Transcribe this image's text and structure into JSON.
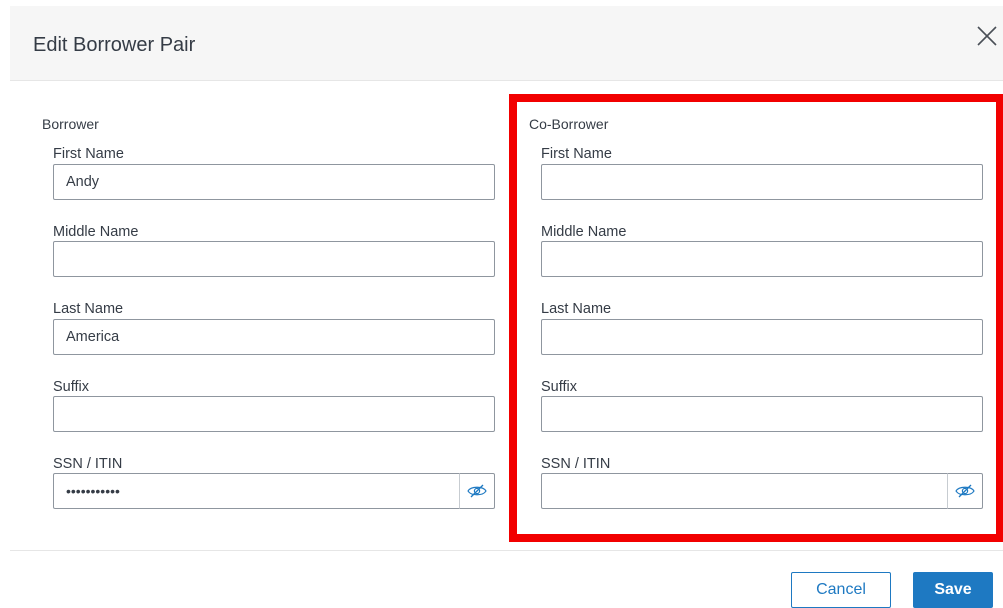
{
  "dialog": {
    "title": "Edit Borrower Pair",
    "close_icon": "close-icon"
  },
  "borrower": {
    "section_label": "Borrower",
    "first_name_label": "First Name",
    "first_name_value": "Andy",
    "middle_name_label": "Middle Name",
    "middle_name_value": "",
    "last_name_label": "Last Name",
    "last_name_value": "America",
    "suffix_label": "Suffix",
    "suffix_value": "",
    "ssn_label": "SSN / ITIN",
    "ssn_value": "•••••••••••"
  },
  "co_borrower": {
    "section_label": "Co-Borrower",
    "first_name_label": "First Name",
    "first_name_value": "",
    "middle_name_label": "Middle Name",
    "middle_name_value": "",
    "last_name_label": "Last Name",
    "last_name_value": "",
    "suffix_label": "Suffix",
    "suffix_value": "",
    "ssn_label": "SSN / ITIN",
    "ssn_value": ""
  },
  "footer": {
    "cancel_label": "Cancel",
    "save_label": "Save"
  },
  "colors": {
    "accent": "#1e79c2",
    "highlight": "#f20000",
    "header_bg": "#f6f6f6"
  }
}
